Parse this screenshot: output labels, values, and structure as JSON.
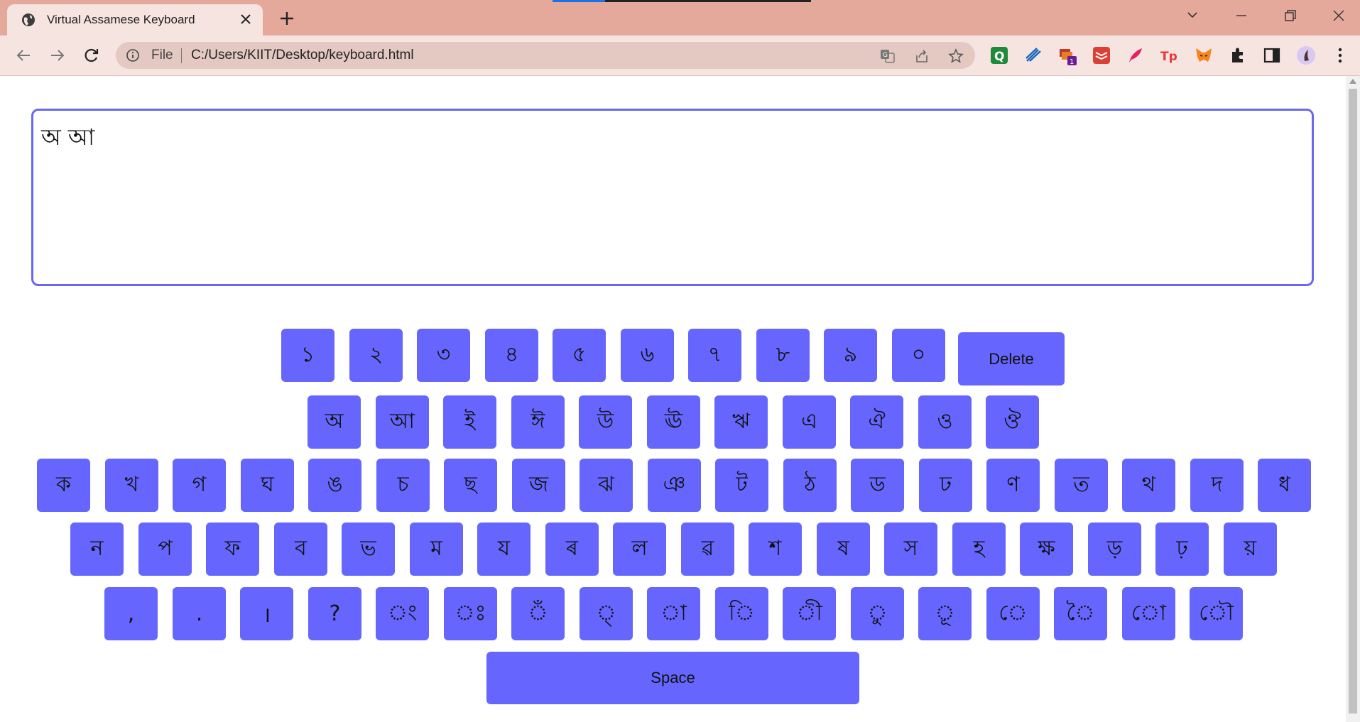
{
  "browser": {
    "tab_title": "Virtual Assamese Keyboard",
    "address_scheme": "File",
    "address_url": "C:/Users/KIIT/Desktop/keyboard.html",
    "extension_badge": "1",
    "accent_color": "#1a73e8"
  },
  "page": {
    "textarea_value": "অ আ",
    "key_color": "#6666ff",
    "textarea_border_color": "#6b68f0"
  },
  "keyboard": {
    "row_digits": [
      "১",
      "২",
      "৩",
      "৪",
      "৫",
      "৬",
      "৭",
      "৮",
      "৯",
      "০"
    ],
    "delete_label": "Delete",
    "row_vowels": [
      "অ",
      "আ",
      "ই",
      "ঈ",
      "উ",
      "ঊ",
      "ঋ",
      "এ",
      "ঐ",
      "ও",
      "ঔ"
    ],
    "row_consonants_1": [
      "ক",
      "খ",
      "গ",
      "ঘ",
      "ঙ",
      "চ",
      "ছ",
      "জ",
      "ঝ",
      "ঞ",
      "ট",
      "ঠ",
      "ড",
      "ঢ",
      "ণ",
      "ত",
      "থ",
      "দ",
      "ধ"
    ],
    "row_consonants_2": [
      "ন",
      "প",
      "ফ",
      "ব",
      "ভ",
      "ম",
      "য",
      "ৰ",
      "ল",
      "ৱ",
      "শ",
      "ষ",
      "স",
      "হ",
      "ক্ষ",
      "ড়",
      "ঢ়",
      "য়"
    ],
    "row_signs": [
      ",",
      ".",
      "।",
      "?",
      "ং",
      "ঃ",
      "ঁ",
      "্",
      "া",
      "ি",
      "ী",
      "ু",
      "ূ",
      "ে",
      "ৈ",
      "ো",
      "ৌ"
    ],
    "space_label": "Space"
  }
}
